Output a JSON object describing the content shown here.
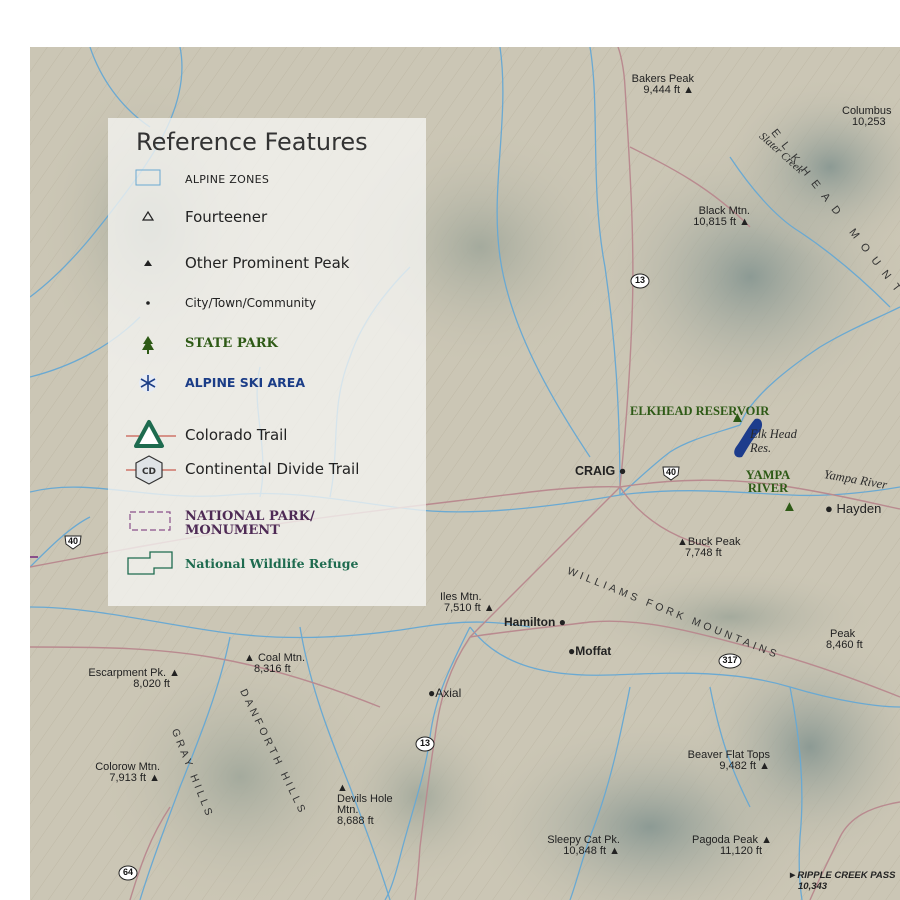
{
  "legend": {
    "title": "Reference Features",
    "items": [
      {
        "label": "ALPINE ZONES",
        "icon": "alpine-zone-box-icon"
      },
      {
        "label": "Fourteener",
        "icon": "hollow-triangle-icon"
      },
      {
        "label": "Other Prominent Peak",
        "icon": "solid-triangle-icon"
      },
      {
        "label": "City/Town/Community",
        "icon": "dot-icon"
      },
      {
        "label": "STATE PARK",
        "icon": "pine-tree-icon",
        "color": "#2e5a16"
      },
      {
        "label": "ALPINE SKI AREA",
        "icon": "snowflake-icon",
        "color": "#1b3d87"
      },
      {
        "label": "Colorado Trail",
        "icon": "colorado-trail-icon",
        "color": "#1e6b4f"
      },
      {
        "label": "Continental Divide Trail",
        "icon": "cdt-badge-icon"
      },
      {
        "label": "NATIONAL PARK/ MONUMENT",
        "icon": "dashed-box-icon",
        "color": "#6b3a6a"
      },
      {
        "label": "National Wildlife Refuge",
        "icon": "refuge-outline-icon",
        "color": "#1e6b4f"
      }
    ]
  },
  "places": {
    "bakers_peak": {
      "name": "Bakers Peak",
      "elev": "9,444 ft"
    },
    "columbus": {
      "name": "Columbus",
      "elev": "10,253"
    },
    "black_mtn": {
      "name": "Black Mtn.",
      "elev": "10,815 ft"
    },
    "craig": "CRAIG",
    "hayden": "Hayden",
    "hamilton": "Hamilton",
    "moffat": "Moffat",
    "axial": "Axial",
    "buck_peak": {
      "name": "Buck Peak",
      "elev": "7,748 ft"
    },
    "iles_mtn": {
      "name": "Iles Mtn.",
      "elev": "7,510 ft"
    },
    "peak_east": {
      "name": "Peak",
      "elev": "8,460 ft"
    },
    "escarpment": {
      "name": "Escarpment Pk.",
      "elev": "8,020 ft"
    },
    "coal_mtn": {
      "name": "Coal Mtn.",
      "elev": "8,316 ft"
    },
    "colorow": {
      "name": "Colorow Mtn.",
      "elev": "7,913 ft"
    },
    "devils_hole": {
      "name": "Devils Hole Mtn.",
      "elev": "8,688 ft"
    },
    "beaver_flat": {
      "name": "Beaver Flat Tops",
      "elev": "9,482 ft"
    },
    "sleepy_cat": {
      "name": "Sleepy Cat Pk.",
      "elev": "10,848 ft"
    },
    "pagoda": {
      "name": "Pagoda Peak",
      "elev": "11,120 ft"
    },
    "ripple_creek": {
      "name": "RIPPLE CREEK PASS",
      "elev": "10,343"
    }
  },
  "water": {
    "elk_head_res": "Elk Head Res.",
    "yampa_river_label": "Yampa River",
    "slater_creek": "Slater Creek"
  },
  "parks": {
    "elkhead": "ELKHEAD RESERVOIR",
    "yampa": "YAMPA RIVER"
  },
  "ranges": {
    "elkhead_mtns": "ELKHEAD MOUNT",
    "williams_fork": "WILLIAMS FORK MOUNTAINS",
    "gray_hills": "GRAY HILLS",
    "danforth": "DANFORTH HILLS"
  },
  "routes": {
    "hwy13_north": "13",
    "us40_east": "40",
    "us40_west": "40",
    "hwy317": "317",
    "hwy13_south": "13",
    "hwy64": "64"
  },
  "colors": {
    "terrain": "#c9c4b3",
    "river": "#6aa9d2",
    "road": "#b98a8f",
    "reservoir": "#1d3c8c",
    "park_green": "#2e5a16"
  }
}
